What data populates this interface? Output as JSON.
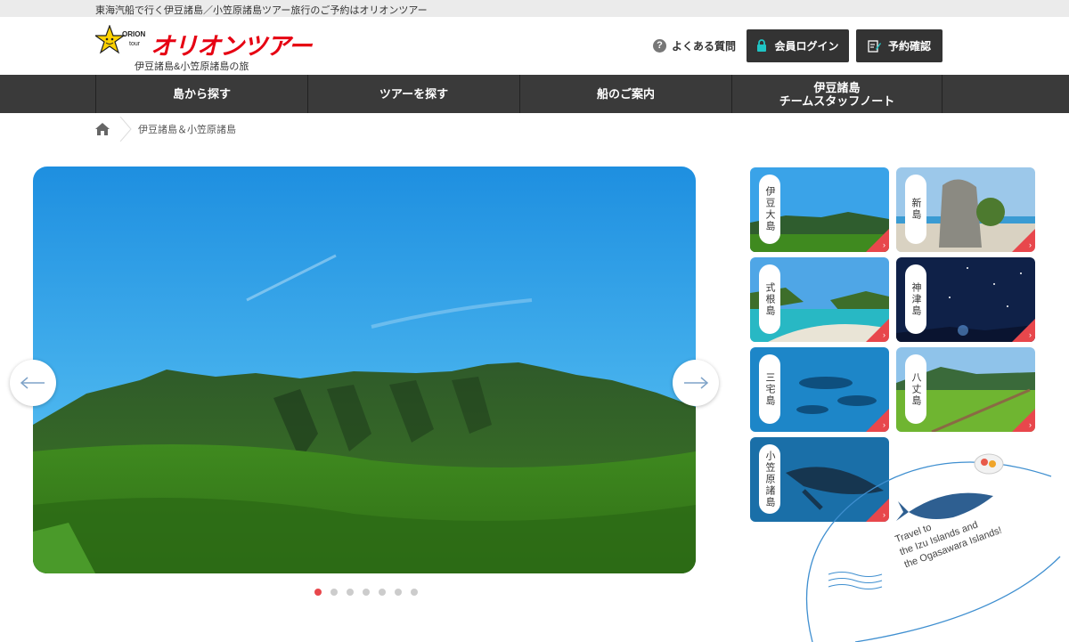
{
  "topbar": {
    "text": "東海汽船で行く伊豆諸島／小笠原諸島ツアー旅行のご予約はオリオンツアー"
  },
  "header": {
    "logo_text": "オリオンツアー",
    "logo_badge": "ORION tour",
    "logo_sub": "伊豆諸島&小笠原諸島の旅",
    "faq_label": "よくある質問",
    "login_label": "会員ログイン",
    "reserve_label": "予約確認"
  },
  "nav": {
    "items": [
      {
        "label": "島から探す"
      },
      {
        "label": "ツアーを探す"
      },
      {
        "label": "船のご案内"
      },
      {
        "label_line1": "伊豆諸島",
        "label_line2": "チームスタッフノート"
      }
    ]
  },
  "breadcrumb": {
    "current": "伊豆諸島＆小笠原諸島"
  },
  "carousel": {
    "slide_count": 7,
    "active_index": 0
  },
  "islands": [
    {
      "name": "伊豆大島"
    },
    {
      "name": "新島"
    },
    {
      "name": "式根島"
    },
    {
      "name": "神津島"
    },
    {
      "name": "三宅島"
    },
    {
      "name": "八丈島"
    },
    {
      "name": "小笠原諸島"
    }
  ],
  "deco": {
    "line1": "Travel to",
    "line2": "the Izu Islands and",
    "line3": "the Ogasawara Islands!"
  },
  "colors": {
    "accent": "#e8474c",
    "nav_bg": "#3a3a3a",
    "logo_red": "#e60012"
  }
}
